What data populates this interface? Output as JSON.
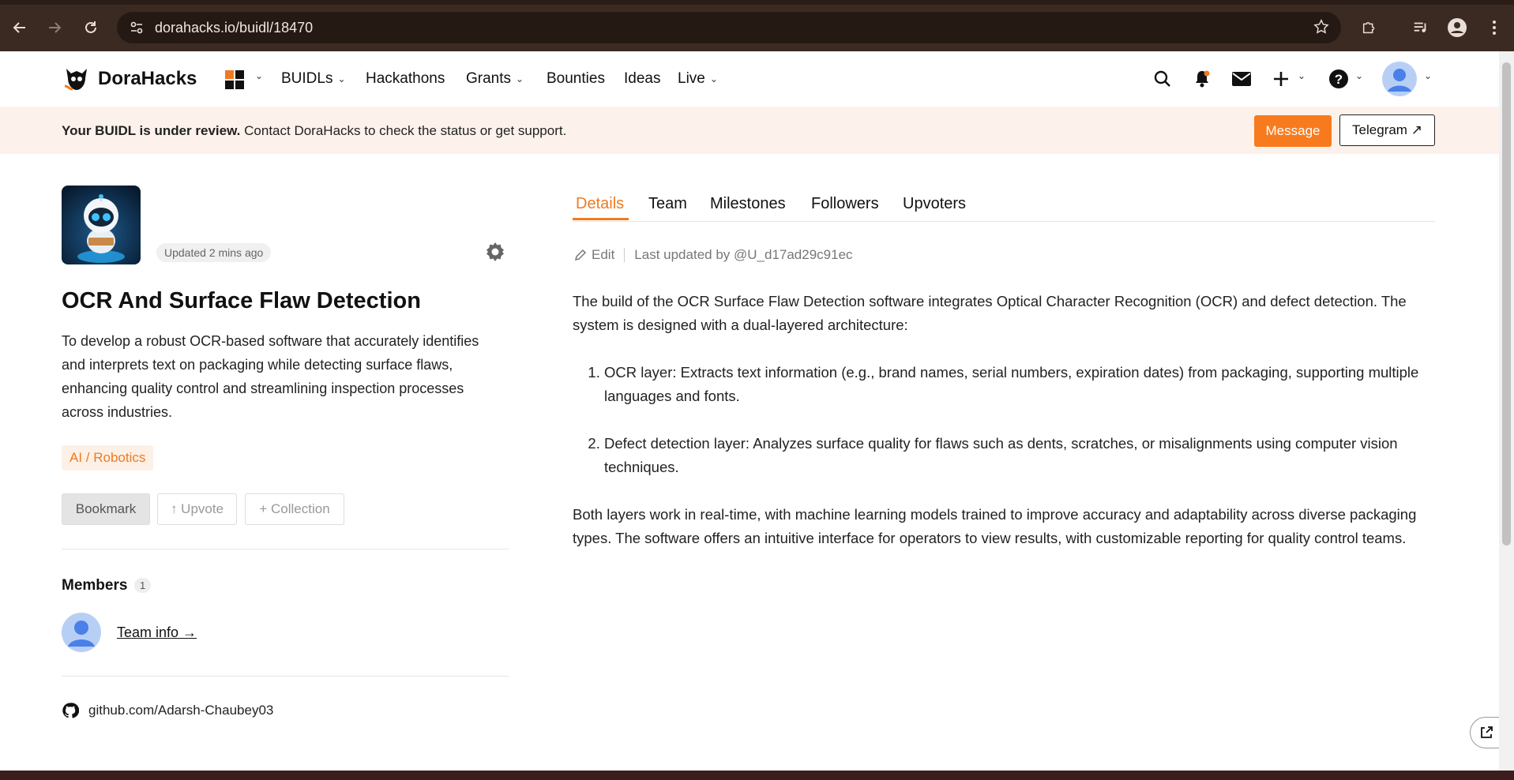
{
  "browser": {
    "url": "dorahacks.io/buidl/18470"
  },
  "header": {
    "logo_text": "DoraHacks",
    "nav": [
      {
        "label": "BUIDLs"
      },
      {
        "label": "Hackathons"
      },
      {
        "label": "Grants"
      },
      {
        "label": "Bounties"
      },
      {
        "label": "Ideas"
      },
      {
        "label": "Live"
      }
    ]
  },
  "banner": {
    "bold_text": "Your BUIDL is under review.",
    "text": " Contact DoraHacks to check the status or get support.",
    "message_label": "Message",
    "telegram_label": "Telegram ↗"
  },
  "project": {
    "updated": "Updated 2 mins ago",
    "title": "OCR And Surface Flaw Detection",
    "description": "To develop a robust OCR-based software that accurately identifies and interprets text on packaging while detecting surface flaws, enhancing quality control and streamlining inspection processes across industries.",
    "tag": "AI / Robotics",
    "bookmark_label": "Bookmark",
    "upvote_label": "↑ Upvote",
    "collection_label": "+ Collection",
    "members_label": "Members",
    "members_count": "1",
    "team_info": "Team info →",
    "github": "github.com/Adarsh-Chaubey03"
  },
  "tabs": [
    "Details",
    "Team",
    "Milestones",
    "Followers",
    "Upvoters"
  ],
  "details": {
    "edit_label": "Edit",
    "last_updated": "Last updated by @U_d17ad29c91ec",
    "intro": "The build of the OCR Surface Flaw Detection software integrates Optical Character Recognition (OCR) and defect detection. The system is designed with a dual-layered architecture:",
    "items": [
      "OCR layer: Extracts text information (e.g., brand names, serial numbers, expiration dates) from packaging, supporting multiple languages and fonts.",
      "Defect detection layer: Analyzes surface quality for flaws such as dents, scratches, or misalignments using computer vision techniques."
    ],
    "outro": "Both layers work in real-time, with machine learning models trained to improve accuracy and adaptability across diverse packaging types. The software offers an intuitive interface for operators to view results, with customizable reporting for quality control teams."
  },
  "colors": {
    "accent": "#f07a20",
    "message_button": "#f77b1e",
    "banner_bg": "#fdf2eb",
    "browser_frame": "#3b2a22"
  }
}
